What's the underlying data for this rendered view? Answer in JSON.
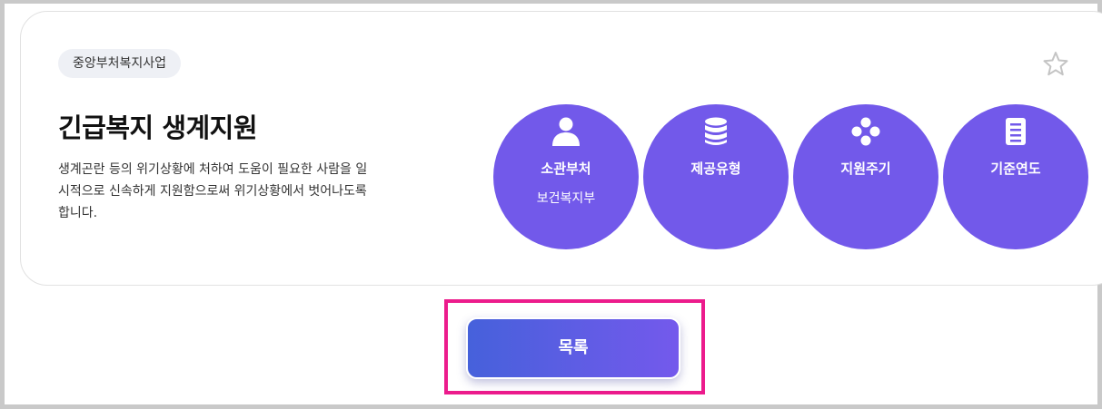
{
  "category_badge": "중앙부처복지사업",
  "title": "긴급복지 생계지원",
  "description": "생계곤란 등의 위기상황에 처하여 도움이 필요한 사람을 일\n시적으로 신속하게 지원함으로써 위기상황에서 벗어나도록\n합니다.",
  "info": [
    {
      "label": "소관부처",
      "value": "보건복지부",
      "icon": "person-icon"
    },
    {
      "label": "제공유형",
      "value": "",
      "icon": "database-icon"
    },
    {
      "label": "지원주기",
      "value": "",
      "icon": "four-dots-icon"
    },
    {
      "label": "기준연도",
      "value": "",
      "icon": "clipboard-icon"
    }
  ],
  "favorite_icon": "star-outline-icon",
  "list_button": "목록",
  "colors": {
    "circle": "#7259ea",
    "highlight": "#ec1b8c",
    "button_start": "#4661db",
    "button_end": "#7459ec"
  }
}
